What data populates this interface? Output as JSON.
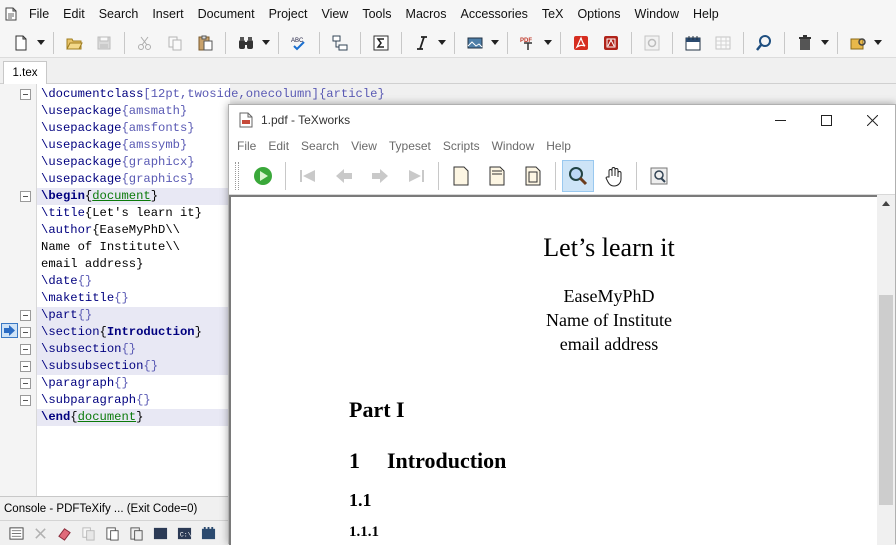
{
  "menu": [
    "File",
    "Edit",
    "Search",
    "Insert",
    "Document",
    "Project",
    "View",
    "Tools",
    "Macros",
    "Accessories",
    "TeX",
    "Options",
    "Window",
    "Help"
  ],
  "toolbar_icons": [
    "new-file-icon",
    "open-folder-icon",
    "save-icon",
    "cut-icon",
    "copy-icon",
    "paste-icon",
    "find-icon",
    "spellcheck-icon",
    "structure-icon",
    "sigma-icon",
    "italic-icon",
    "image-icon",
    "pdf-tex-icon",
    "acrobat-icon",
    "acrobat-shield-icon",
    "settings-icon",
    "calendar-icon",
    "grid-icon",
    "search-icon",
    "trash-icon",
    "package-icon"
  ],
  "tab": {
    "label": "1.tex"
  },
  "code_lines": [
    {
      "kind": "cmdarg",
      "cmd": "\\documentclass",
      "opt": "[12pt,twoside,onecolumn]",
      "arg": "{article}",
      "fold": true
    },
    {
      "kind": "cmdarg",
      "cmd": "\\usepackage",
      "arg": "{amsmath}"
    },
    {
      "kind": "cmdarg",
      "cmd": "\\usepackage",
      "arg": "{amsfonts}"
    },
    {
      "kind": "cmdarg",
      "cmd": "\\usepackage",
      "arg": "{amssymb}"
    },
    {
      "kind": "cmdarg",
      "cmd": "\\usepackage",
      "arg": "{graphicx}"
    },
    {
      "kind": "cmdarg",
      "cmd": "\\usepackage",
      "arg": "{graphics}"
    },
    {
      "kind": "env",
      "cmd": "\\begin",
      "arg": "document",
      "fold": true,
      "hl": true
    },
    {
      "kind": "cmdtext",
      "cmd": "\\title",
      "text": "{Let's learn it}"
    },
    {
      "kind": "cmdtext",
      "cmd": "\\author",
      "text": "{EaseMyPhD\\\\"
    },
    {
      "kind": "text",
      "text": "Name of Institute\\\\"
    },
    {
      "kind": "text",
      "text": "email address}"
    },
    {
      "kind": "cmdarg",
      "cmd": "\\date",
      "arg": "{}"
    },
    {
      "kind": "cmdarg",
      "cmd": "\\maketitle",
      "arg": "{}"
    },
    {
      "kind": "cmdarg",
      "cmd": "\\part",
      "arg": "{}",
      "fold": true,
      "hl": true
    },
    {
      "kind": "section",
      "cmd": "\\section",
      "arg": "Introduction",
      "fold": true,
      "hl": true
    },
    {
      "kind": "cmdarg",
      "cmd": "\\subsection",
      "arg": "{}",
      "fold": true,
      "hl": true
    },
    {
      "kind": "cmdarg",
      "cmd": "\\subsubsection",
      "arg": "{}",
      "fold": true,
      "hl": true
    },
    {
      "kind": "cmdarg",
      "cmd": "\\paragraph",
      "arg": "{}",
      "fold": true
    },
    {
      "kind": "cmdarg",
      "cmd": "\\subparagraph",
      "arg": "{}",
      "fold": true
    },
    {
      "kind": "env",
      "cmd": "\\end",
      "arg": "document",
      "hl": true
    }
  ],
  "console": {
    "title": "Console - PDFTeXify ... (Exit Code=0)",
    "icons": [
      "console-icon",
      "close-icon",
      "eraser-icon",
      "copy-icon",
      "paste-icon",
      "copy-all-icon",
      "terminal-icon",
      "cmd-icon",
      "tools-icon"
    ]
  },
  "texworks": {
    "title": "1.pdf - TeXworks",
    "menu": [
      "File",
      "Edit",
      "Search",
      "View",
      "Typeset",
      "Scripts",
      "Window",
      "Help"
    ],
    "toolbar_icons": [
      "typeset-play-icon",
      "first-page-icon",
      "previous-page-icon",
      "next-page-icon",
      "last-page-icon",
      "actual-size-icon",
      "fit-width-icon",
      "fit-window-icon",
      "magnifier-icon",
      "hand-icon",
      "find-document-icon"
    ],
    "pdf": {
      "title": "Let’s learn it",
      "author_lines": [
        "EaseMyPhD",
        "Name of Institute",
        "email address"
      ],
      "part": "Part I",
      "section_num": "1",
      "section_title": "Introduction",
      "subsection_num": "1.1",
      "subsubsection_num": "1.1.1"
    }
  },
  "colors": {
    "command": "#00007f",
    "argument": "#5a5ab4",
    "environment": "#0a7a0a",
    "toolbar_active": "#cde4f7"
  }
}
